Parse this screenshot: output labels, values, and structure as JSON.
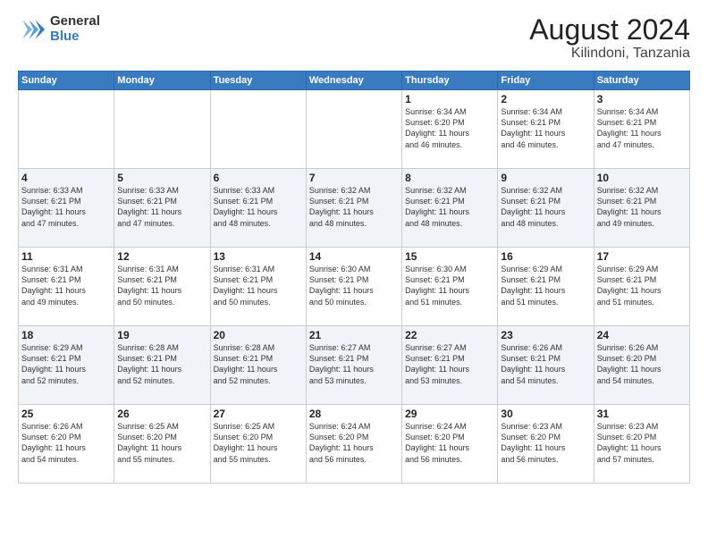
{
  "logo": {
    "general": "General",
    "blue": "Blue"
  },
  "title": {
    "month_year": "August 2024",
    "location": "Kilindoni, Tanzania"
  },
  "weekdays": [
    "Sunday",
    "Monday",
    "Tuesday",
    "Wednesday",
    "Thursday",
    "Friday",
    "Saturday"
  ],
  "weeks": [
    [
      {
        "day": "",
        "info": ""
      },
      {
        "day": "",
        "info": ""
      },
      {
        "day": "",
        "info": ""
      },
      {
        "day": "",
        "info": ""
      },
      {
        "day": "1",
        "info": "Sunrise: 6:34 AM\nSunset: 6:20 PM\nDaylight: 11 hours\nand 46 minutes."
      },
      {
        "day": "2",
        "info": "Sunrise: 6:34 AM\nSunset: 6:21 PM\nDaylight: 11 hours\nand 46 minutes."
      },
      {
        "day": "3",
        "info": "Sunrise: 6:34 AM\nSunset: 6:21 PM\nDaylight: 11 hours\nand 47 minutes."
      }
    ],
    [
      {
        "day": "4",
        "info": "Sunrise: 6:33 AM\nSunset: 6:21 PM\nDaylight: 11 hours\nand 47 minutes."
      },
      {
        "day": "5",
        "info": "Sunrise: 6:33 AM\nSunset: 6:21 PM\nDaylight: 11 hours\nand 47 minutes."
      },
      {
        "day": "6",
        "info": "Sunrise: 6:33 AM\nSunset: 6:21 PM\nDaylight: 11 hours\nand 48 minutes."
      },
      {
        "day": "7",
        "info": "Sunrise: 6:32 AM\nSunset: 6:21 PM\nDaylight: 11 hours\nand 48 minutes."
      },
      {
        "day": "8",
        "info": "Sunrise: 6:32 AM\nSunset: 6:21 PM\nDaylight: 11 hours\nand 48 minutes."
      },
      {
        "day": "9",
        "info": "Sunrise: 6:32 AM\nSunset: 6:21 PM\nDaylight: 11 hours\nand 48 minutes."
      },
      {
        "day": "10",
        "info": "Sunrise: 6:32 AM\nSunset: 6:21 PM\nDaylight: 11 hours\nand 49 minutes."
      }
    ],
    [
      {
        "day": "11",
        "info": "Sunrise: 6:31 AM\nSunset: 6:21 PM\nDaylight: 11 hours\nand 49 minutes."
      },
      {
        "day": "12",
        "info": "Sunrise: 6:31 AM\nSunset: 6:21 PM\nDaylight: 11 hours\nand 50 minutes."
      },
      {
        "day": "13",
        "info": "Sunrise: 6:31 AM\nSunset: 6:21 PM\nDaylight: 11 hours\nand 50 minutes."
      },
      {
        "day": "14",
        "info": "Sunrise: 6:30 AM\nSunset: 6:21 PM\nDaylight: 11 hours\nand 50 minutes."
      },
      {
        "day": "15",
        "info": "Sunrise: 6:30 AM\nSunset: 6:21 PM\nDaylight: 11 hours\nand 51 minutes."
      },
      {
        "day": "16",
        "info": "Sunrise: 6:29 AM\nSunset: 6:21 PM\nDaylight: 11 hours\nand 51 minutes."
      },
      {
        "day": "17",
        "info": "Sunrise: 6:29 AM\nSunset: 6:21 PM\nDaylight: 11 hours\nand 51 minutes."
      }
    ],
    [
      {
        "day": "18",
        "info": "Sunrise: 6:29 AM\nSunset: 6:21 PM\nDaylight: 11 hours\nand 52 minutes."
      },
      {
        "day": "19",
        "info": "Sunrise: 6:28 AM\nSunset: 6:21 PM\nDaylight: 11 hours\nand 52 minutes."
      },
      {
        "day": "20",
        "info": "Sunrise: 6:28 AM\nSunset: 6:21 PM\nDaylight: 11 hours\nand 52 minutes."
      },
      {
        "day": "21",
        "info": "Sunrise: 6:27 AM\nSunset: 6:21 PM\nDaylight: 11 hours\nand 53 minutes."
      },
      {
        "day": "22",
        "info": "Sunrise: 6:27 AM\nSunset: 6:21 PM\nDaylight: 11 hours\nand 53 minutes."
      },
      {
        "day": "23",
        "info": "Sunrise: 6:26 AM\nSunset: 6:21 PM\nDaylight: 11 hours\nand 54 minutes."
      },
      {
        "day": "24",
        "info": "Sunrise: 6:26 AM\nSunset: 6:20 PM\nDaylight: 11 hours\nand 54 minutes."
      }
    ],
    [
      {
        "day": "25",
        "info": "Sunrise: 6:26 AM\nSunset: 6:20 PM\nDaylight: 11 hours\nand 54 minutes."
      },
      {
        "day": "26",
        "info": "Sunrise: 6:25 AM\nSunset: 6:20 PM\nDaylight: 11 hours\nand 55 minutes."
      },
      {
        "day": "27",
        "info": "Sunrise: 6:25 AM\nSunset: 6:20 PM\nDaylight: 11 hours\nand 55 minutes."
      },
      {
        "day": "28",
        "info": "Sunrise: 6:24 AM\nSunset: 6:20 PM\nDaylight: 11 hours\nand 56 minutes."
      },
      {
        "day": "29",
        "info": "Sunrise: 6:24 AM\nSunset: 6:20 PM\nDaylight: 11 hours\nand 56 minutes."
      },
      {
        "day": "30",
        "info": "Sunrise: 6:23 AM\nSunset: 6:20 PM\nDaylight: 11 hours\nand 56 minutes."
      },
      {
        "day": "31",
        "info": "Sunrise: 6:23 AM\nSunset: 6:20 PM\nDaylight: 11 hours\nand 57 minutes."
      }
    ]
  ]
}
